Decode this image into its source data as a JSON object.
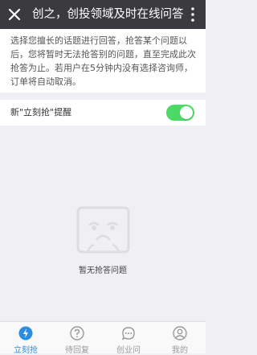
{
  "header": {
    "title": "创之，创投领域及时在线问答..."
  },
  "notice": {
    "text": "选择您擅长的话题进行回答，抢答某个问题以后，您将暂时无法抢答别的问题，直至完成此次抢答为止。若用户在5分钟内没有选择咨询师，订单将自动取消。"
  },
  "setting": {
    "label": "新\"立刻抢\"提醒",
    "enabled": true
  },
  "empty_state": {
    "text": "暂无抢答问题"
  },
  "tabs": [
    {
      "label": "立刻抢",
      "icon": "lightning-icon",
      "active": true
    },
    {
      "label": "待回复",
      "icon": "question-icon",
      "active": false
    },
    {
      "label": "创业问",
      "icon": "chat-icon",
      "active": false
    },
    {
      "label": "我的",
      "icon": "user-icon",
      "active": false
    }
  ],
  "colors": {
    "topbar": "#3b3b3f",
    "toggle_on": "#4cd964",
    "active_tab": "#2a8de0",
    "background": "#efeff4"
  }
}
